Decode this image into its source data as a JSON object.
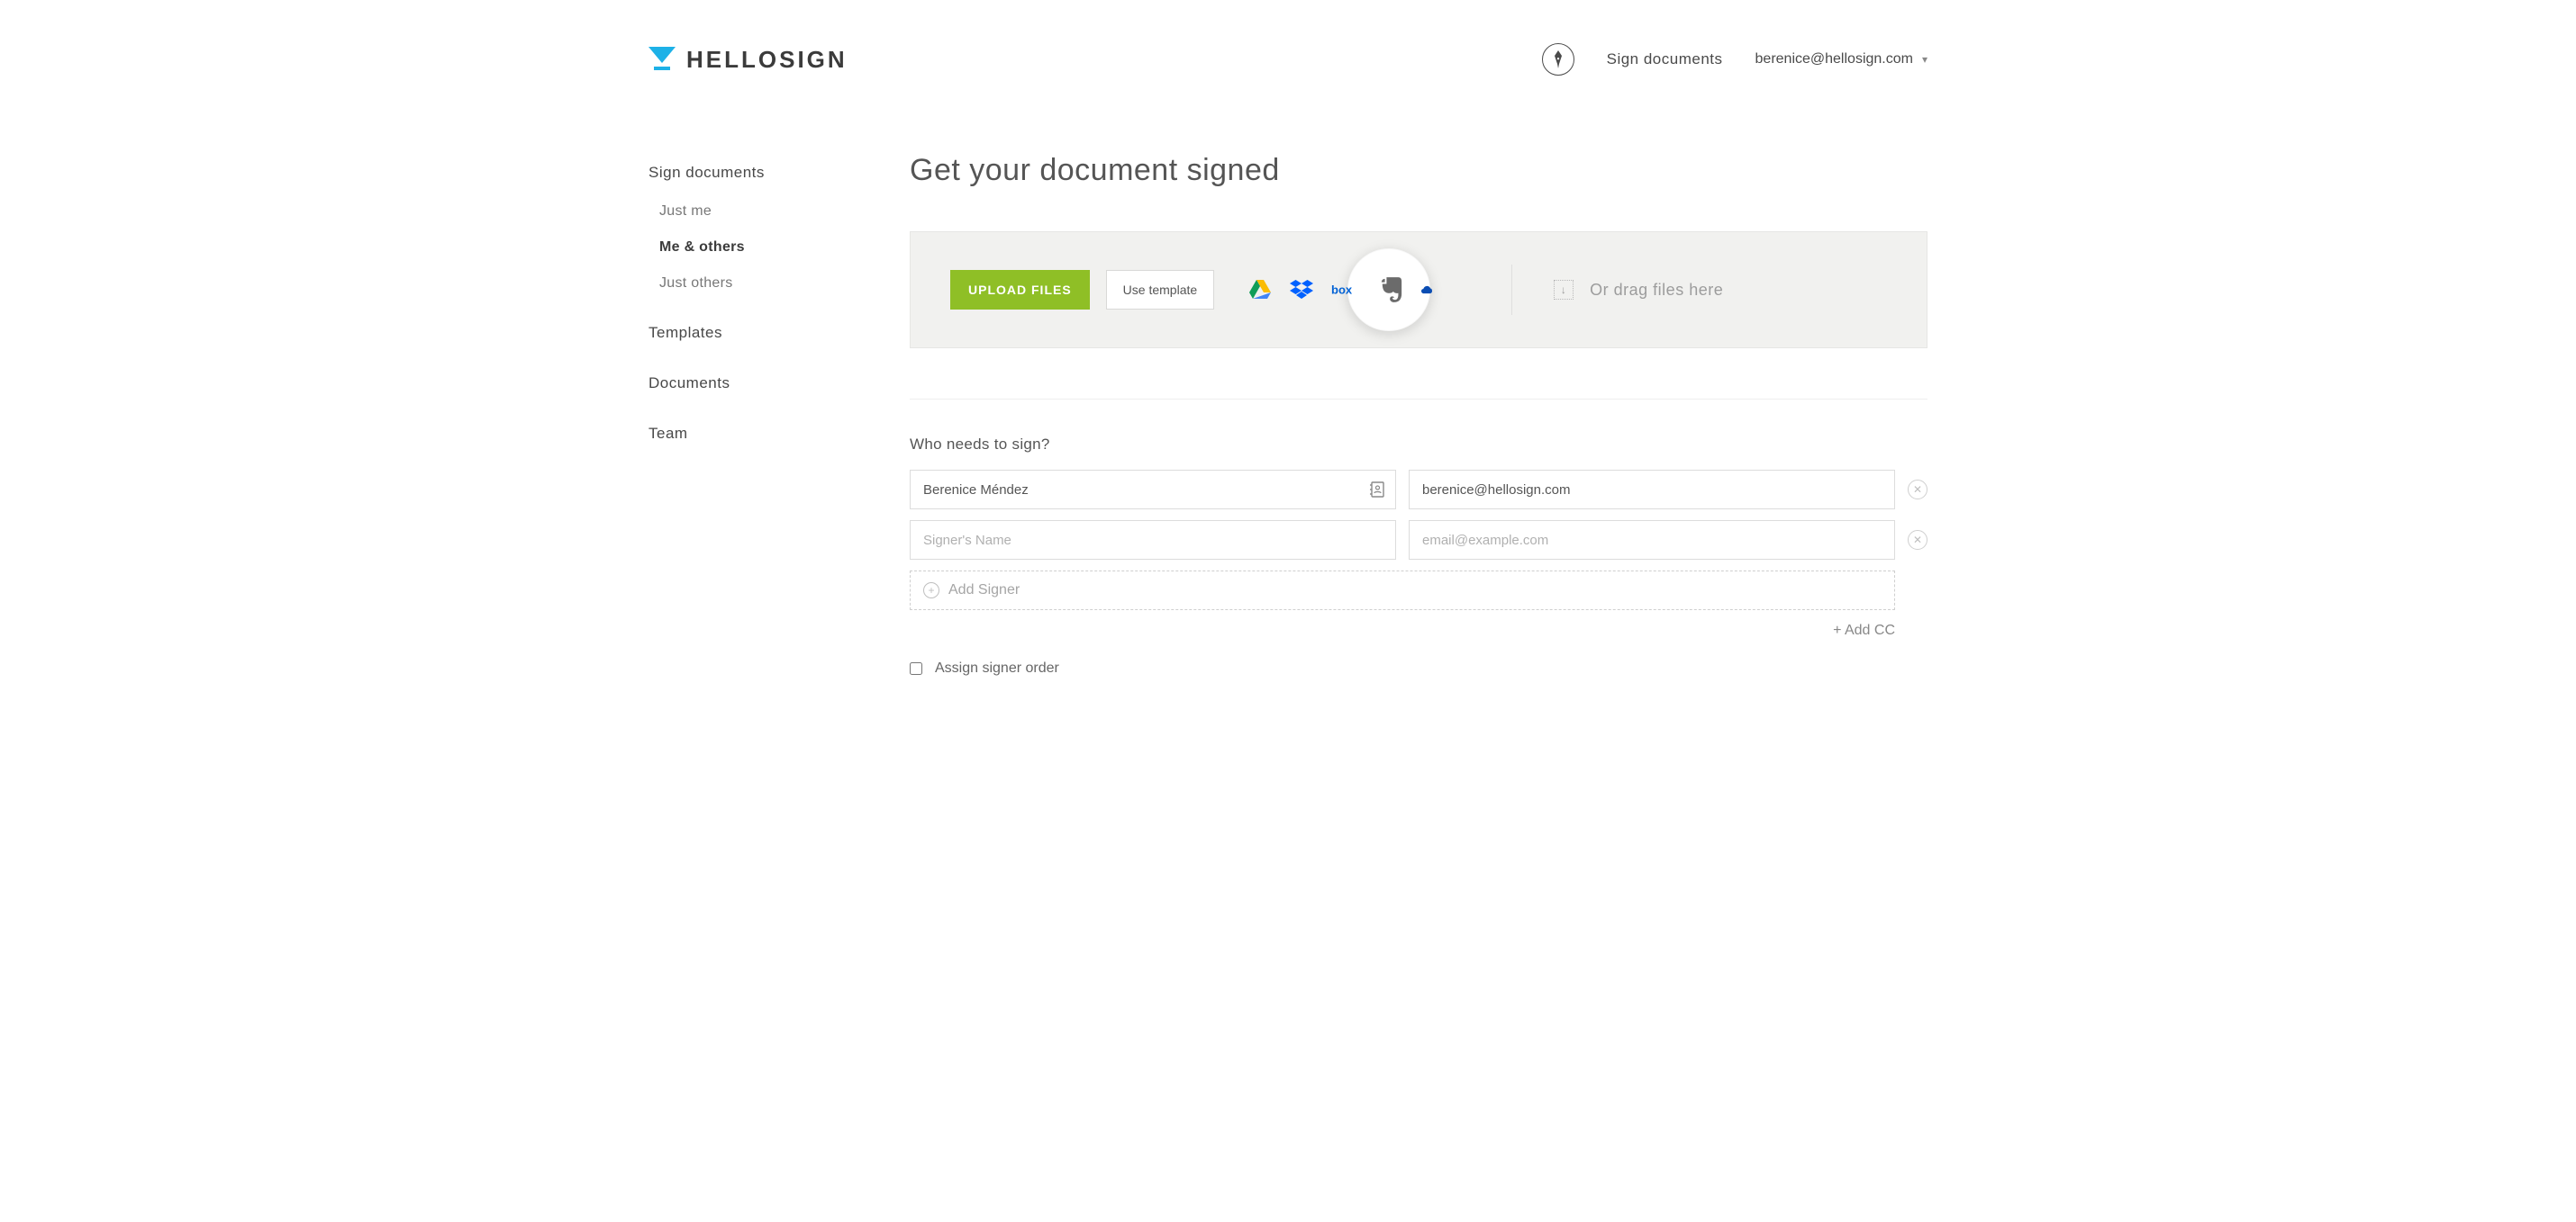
{
  "brand": {
    "name": "HELLOSIGN"
  },
  "header": {
    "sign_link": "Sign documents",
    "user_email": "berenice@hellosign.com"
  },
  "sidebar": {
    "items": [
      {
        "label": "Sign documents",
        "type": "top"
      },
      {
        "label": "Just me",
        "type": "sub"
      },
      {
        "label": "Me & others",
        "type": "sub",
        "active": true
      },
      {
        "label": "Just others",
        "type": "sub"
      },
      {
        "label": "Templates",
        "type": "top"
      },
      {
        "label": "Documents",
        "type": "top"
      },
      {
        "label": "Team",
        "type": "top"
      }
    ]
  },
  "main": {
    "title": "Get your document signed",
    "upload": {
      "upload_button": "UPLOAD FILES",
      "template_button": "Use template",
      "sources": [
        "google-drive",
        "dropbox",
        "box",
        "evernote",
        "onedrive"
      ],
      "drag_hint": "Or drag files here"
    },
    "signers": {
      "heading": "Who needs to sign?",
      "rows": [
        {
          "name": "Berenice Méndez",
          "email": "berenice@hellosign.com"
        },
        {
          "name": "",
          "email": ""
        }
      ],
      "name_placeholder": "Signer's Name",
      "email_placeholder": "email@example.com",
      "add_signer": "Add Signer",
      "add_cc": "+ Add CC",
      "assign_order": "Assign signer order"
    }
  },
  "colors": {
    "accent_blue": "#1db1e7",
    "upload_green": "#8fbf26"
  }
}
